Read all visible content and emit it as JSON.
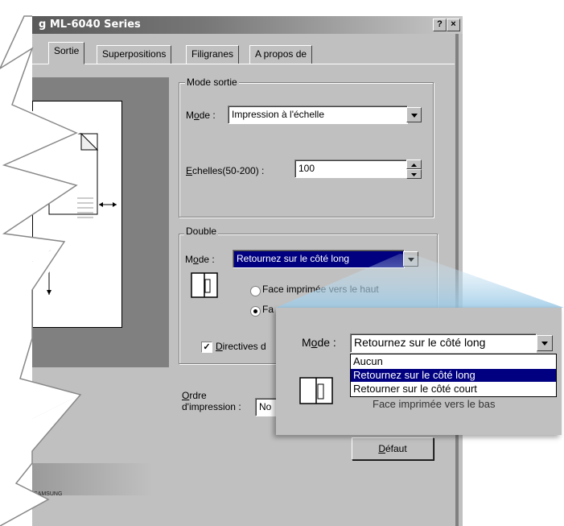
{
  "window": {
    "title": "g ML-6040 Series",
    "help_button": "?",
    "close_button": "×"
  },
  "tabs": [
    {
      "label": "Sortie",
      "active": true
    },
    {
      "label": "Superpositions"
    },
    {
      "label": "Filigranes"
    },
    {
      "label": "A propos de"
    }
  ],
  "mode_sortie": {
    "group_label": "Mode sortie",
    "mode_label_prefix": "M",
    "mode_label_underline": "o",
    "mode_label_suffix": "de :",
    "mode_value": "Impression à l'échelle",
    "echelles_label_underline": "E",
    "echelles_label_suffix": "chelles(50-200) :",
    "echelles_value": "100"
  },
  "double": {
    "group_label": "Double",
    "mode_label_prefix": "M",
    "mode_label_underline": "o",
    "mode_label_suffix": "de :",
    "mode_value": "Retournez sur le côté long",
    "radio1_label": "Face imprimée vers le haut",
    "radio1_checked": false,
    "radio2_label": "Fa",
    "radio2_checked": true,
    "checkbox_label_underline": "D",
    "checkbox_label_suffix": "irectives d",
    "checkbox_checked": true
  },
  "ordre": {
    "label_line1_underline": "O",
    "label_line1_suffix": "rdre",
    "label_line2": "d'impression :",
    "value": "No"
  },
  "buttons": {
    "defaut_underline": "D",
    "defaut_suffix": "éfaut"
  },
  "footer_text": "SAMSUNG",
  "zoom": {
    "mode_label_prefix": "M",
    "mode_label_underline": "o",
    "mode_label_suffix": "de :",
    "mode_value": "Retournez sur le côté long",
    "options": [
      {
        "label": "Aucun",
        "selected": false
      },
      {
        "label": "Retournez sur le côté long",
        "selected": true
      },
      {
        "label": "Retourner sur le côté court",
        "selected": false
      }
    ],
    "hidden_text": "Face imprimée vers le bas"
  },
  "colors": {
    "dialog_bg": "#c0c0c0",
    "selection": "#000080",
    "beam": "#bcd8ec"
  }
}
